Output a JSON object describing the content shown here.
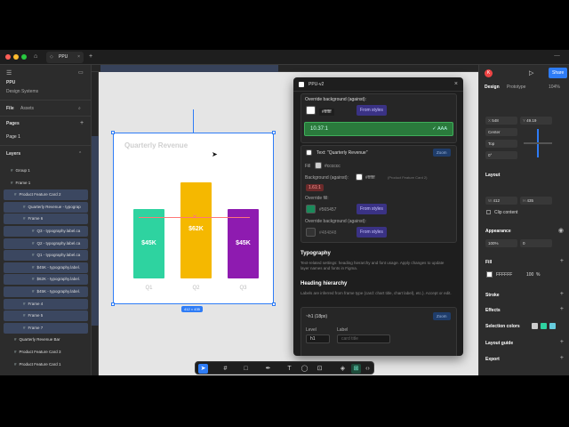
{
  "window": {
    "tab_title": "PPU",
    "file_name": "PPU",
    "team": "Design Systems"
  },
  "left_sidebar": {
    "tabs": [
      "File",
      "Assets"
    ],
    "pages_label": "Pages",
    "current_page": "Page 1",
    "layers_label": "Layers",
    "layers": [
      {
        "label": "Group 1",
        "selected": false
      },
      {
        "label": "Frame 1",
        "selected": false
      },
      {
        "label": "Product Feature Card 2",
        "selected": true
      },
      {
        "label": "Quarterly Revenue - typograp",
        "selected": true
      },
      {
        "label": "Frame 6",
        "selected": true
      },
      {
        "label": "Q3 - typography.label.ca",
        "selected": true
      },
      {
        "label": "Q2 - typography.label.ca",
        "selected": true
      },
      {
        "label": "Q1 - typography.label.ca",
        "selected": true
      },
      {
        "label": "$45K - typography.label.",
        "selected": true
      },
      {
        "label": "$62K - typography.label.",
        "selected": true
      },
      {
        "label": "$45K - typography.label.",
        "selected": true
      },
      {
        "label": "Frame 4",
        "selected": true
      },
      {
        "label": "Frame 5",
        "selected": true
      },
      {
        "label": "Frame 7",
        "selected": true
      },
      {
        "label": "Quarterly Revenue Bar",
        "selected": false
      },
      {
        "label": "Product Feature Card 3",
        "selected": false
      },
      {
        "label": "Product Feature Card 1",
        "selected": false
      }
    ]
  },
  "canvas": {
    "card_title": "Quarterly Revenue",
    "size_badge": "412 × 435"
  },
  "chart_data": {
    "type": "bar",
    "title": "Quarterly Revenue",
    "categories": [
      "Q1",
      "Q2",
      "Q3"
    ],
    "values": [
      45,
      62,
      45
    ],
    "value_labels": [
      "$45K",
      "$62K",
      "$45K"
    ],
    "colors": [
      "#2ed3a0",
      "#f5b800",
      "#8e1bb0"
    ]
  },
  "plugin": {
    "title": "PPU-v2",
    "override_bg_label_1": "Override background (against):",
    "override_bg_hex_1": "#ffffff",
    "from_styles": "From styles",
    "contrast_ratio": "10.37:1",
    "contrast_grade": "✓ AAA",
    "text_item": "Text: \"Quarterly Revenue\"",
    "zoom_btn": "Zoom",
    "fill_label": "Fill",
    "fill_hex": "#cccccc",
    "bg_against_label": "Background (against):",
    "bg_against_hex": "#ffffff",
    "bg_against_note": "(Product Feature Card 2)",
    "fail_ratio": "1.61:1",
    "override_fill_label": "Override fill:",
    "override_fill_hex": "#565457",
    "override_bg_label_2": "Override background (against):",
    "override_bg_hex_2": "#484848",
    "typography_heading": "Typography",
    "typography_desc": "Text-related settings: heading hierarchy and font usage. Apply changes to update layer names and fonts in Figma.",
    "heading_hierarchy": "Heading hierarchy",
    "heading_desc": "Labels are inferred from frame type (card: chart title, chart label), etc.). Accept or edit.",
    "h1_item": "~h1 (18px)",
    "level_label": "Level",
    "label_label": "Label",
    "level_value": "h1",
    "label_placeholder": "card title"
  },
  "right_panel": {
    "tabs": [
      "Design",
      "Prototype"
    ],
    "zoom": "104%",
    "share": "Share",
    "x": "548",
    "y": "49.19",
    "align_h": "Center",
    "align_v": "Top",
    "rotation": "0°",
    "w": "412",
    "h": "435",
    "clip_content": "Clip content",
    "layout": "Layout",
    "appearance": "Appearance",
    "opacity": "100%",
    "corner": "0",
    "fill_heading": "Fill",
    "fill_hex": "FFFFFF",
    "fill_opacity": "100",
    "fill_pct": "%",
    "stroke": "Stroke",
    "effects": "Effects",
    "selection_colors": "Selection colors",
    "layout_guide": "Layout guide",
    "export": "Export"
  }
}
